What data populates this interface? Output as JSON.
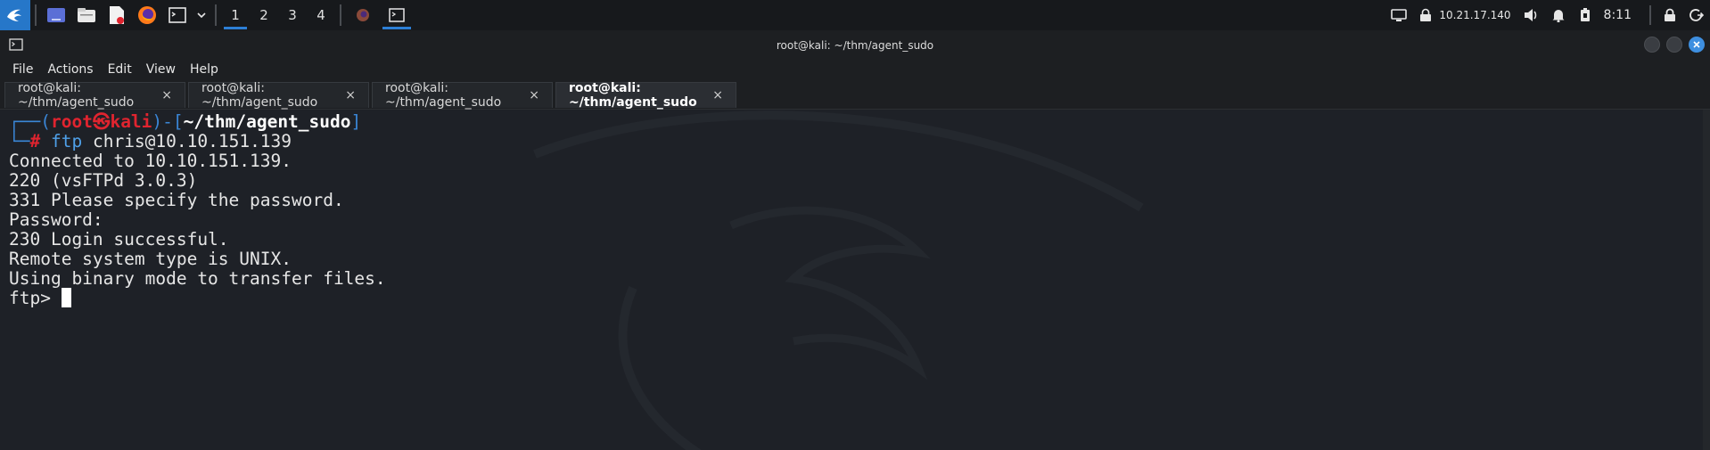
{
  "panel": {
    "workspaces": [
      "1",
      "2",
      "3",
      "4"
    ],
    "active_workspace": "1",
    "ip": "10.21.17.140",
    "clock": "8:11"
  },
  "window": {
    "title": "root@kali: ~/thm/agent_sudo",
    "menu": [
      "File",
      "Actions",
      "Edit",
      "View",
      "Help"
    ],
    "tabs": [
      {
        "label": "root@kali: ~/thm/agent_sudo",
        "active": false
      },
      {
        "label": "root@kali: ~/thm/agent_sudo",
        "active": false
      },
      {
        "label": "root@kali: ~/thm/agent_sudo",
        "active": false
      },
      {
        "label": "root@kali: ~/thm/agent_sudo",
        "active": true
      }
    ],
    "tab_close": "×"
  },
  "terminal": {
    "prompt": {
      "user": "root",
      "host": "kali",
      "cwd": "~/thm/agent_sudo",
      "symbol": "#",
      "command": "ftp",
      "args": "chris@10.10.151.139"
    },
    "output": [
      "Connected to 10.10.151.139.",
      "220 (vsFTPd 3.0.3)",
      "331 Please specify the password.",
      "Password:",
      "230 Login successful.",
      "Remote system type is UNIX.",
      "Using binary mode to transfer files."
    ],
    "ftp_prompt": "ftp>"
  },
  "colors": {
    "accent": "#2d7fd6",
    "prompt_red": "#e0242f",
    "prompt_blue": "#3a86d6",
    "background": "#1e2127"
  }
}
